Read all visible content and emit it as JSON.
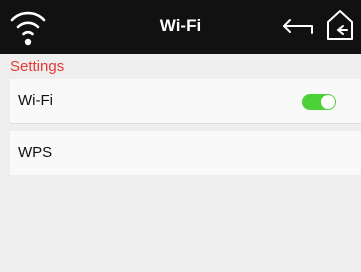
{
  "header": {
    "title": "Wi-Fi",
    "status_icon": "wifi-signal-icon",
    "back_icon": "back-arrow-icon",
    "home_icon": "home-icon"
  },
  "section": {
    "label": "Settings",
    "color": "#e53935"
  },
  "items": [
    {
      "label": "Wi-Fi",
      "toggle": true,
      "toggle_color": "#4cd137"
    },
    {
      "label": "WPS"
    }
  ]
}
